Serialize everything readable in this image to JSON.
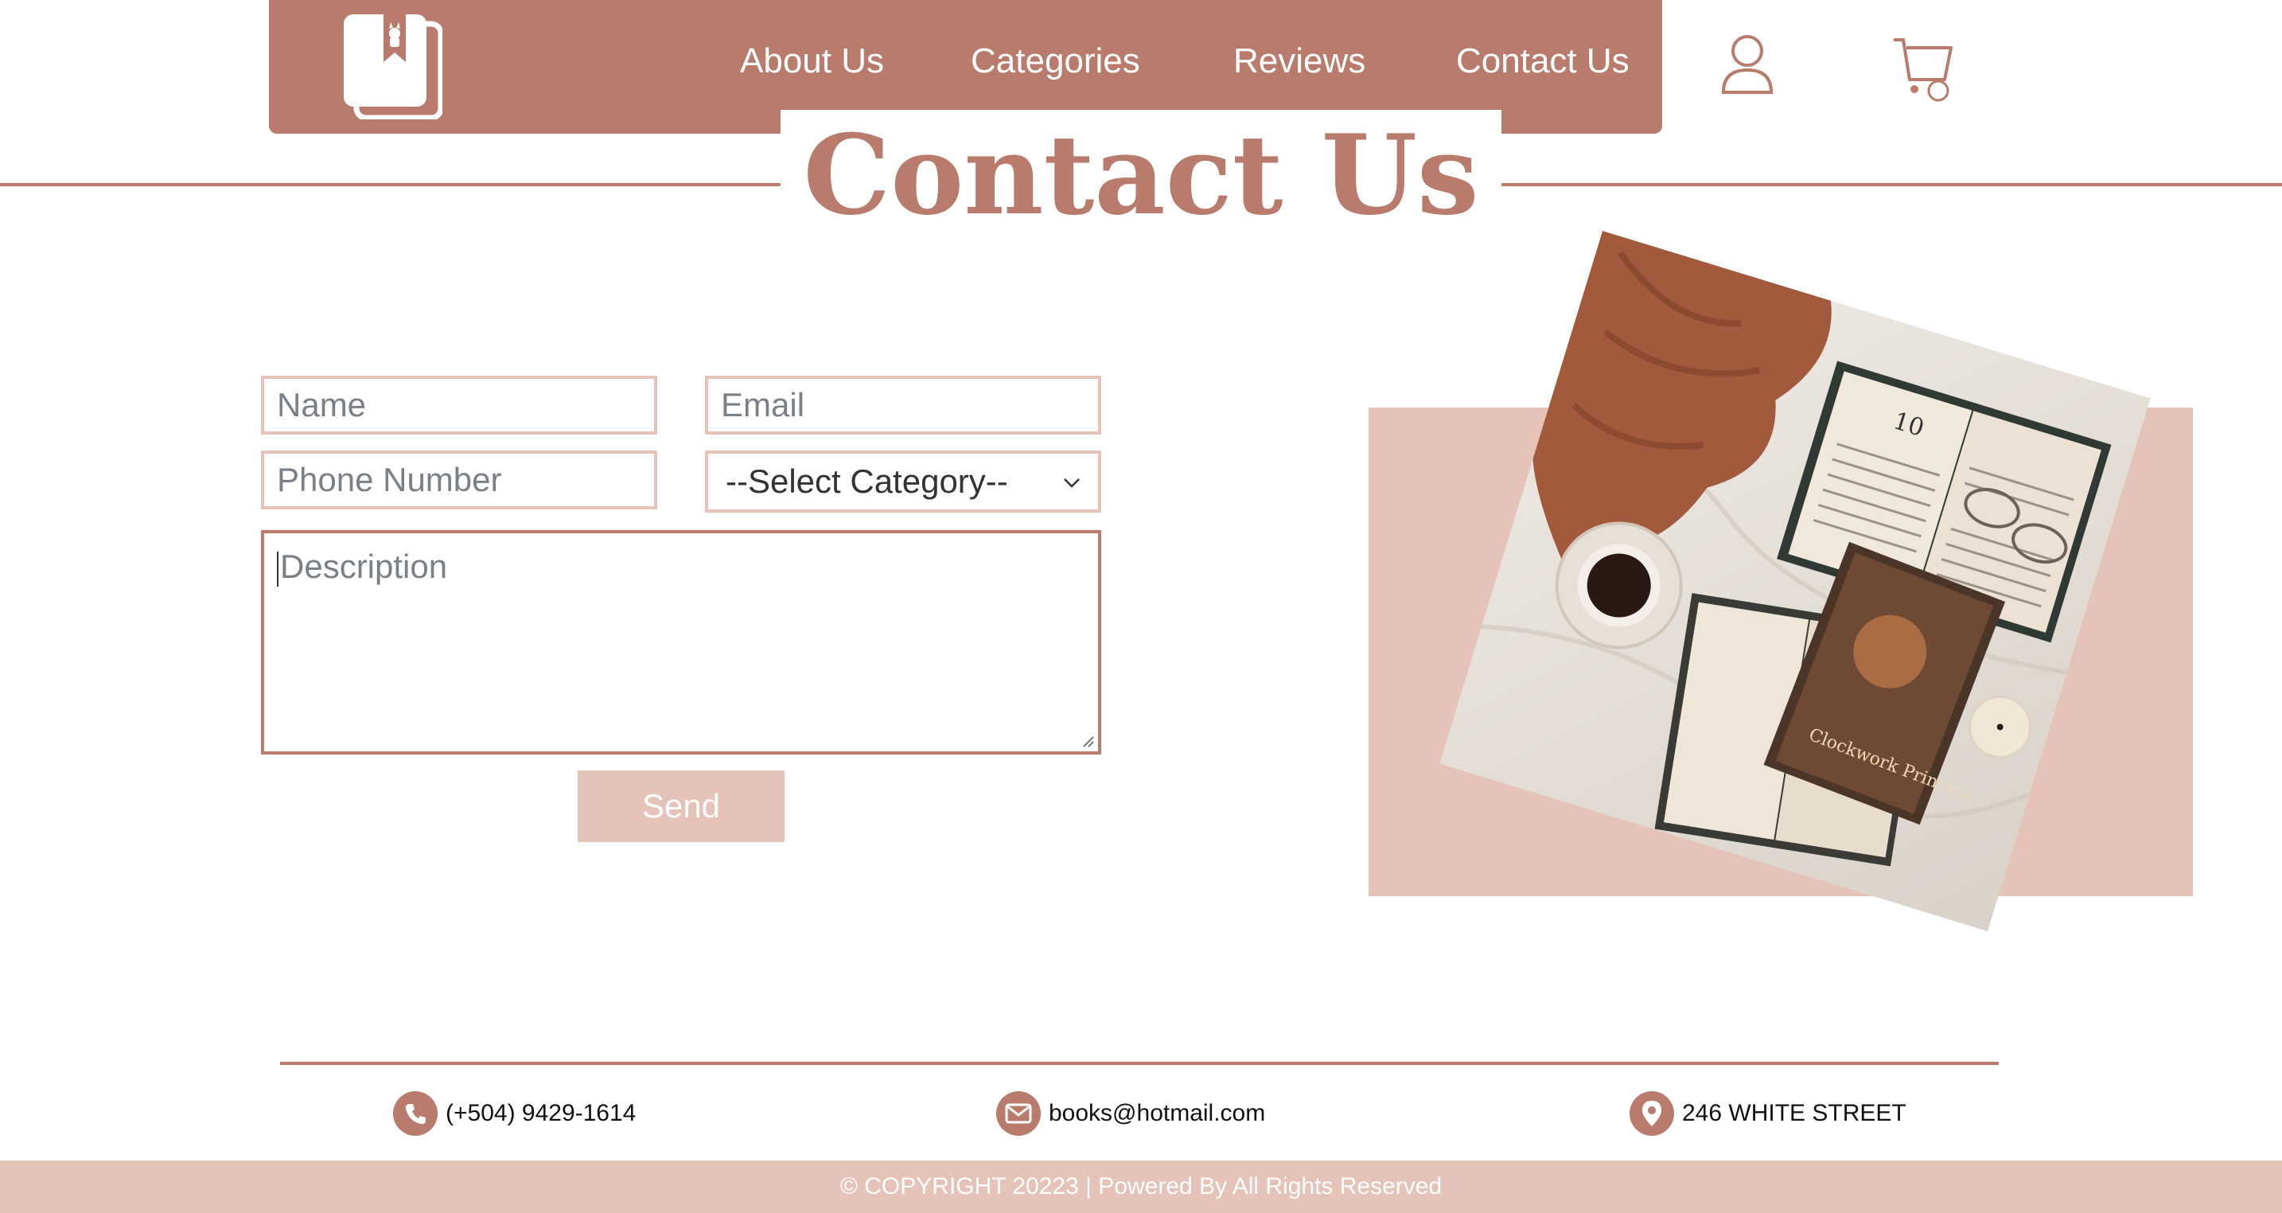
{
  "nav": {
    "links": [
      "About Us",
      "Categories",
      "Reviews",
      "Contact Us"
    ],
    "icons": [
      "books-logo-icon",
      "user-icon",
      "cart-icon"
    ]
  },
  "page": {
    "title": "Contact Us"
  },
  "form": {
    "name_placeholder": "Name",
    "email_placeholder": "Email",
    "phone_placeholder": "Phone Number",
    "category_selected": "--Select Category--",
    "description_placeholder": "Description",
    "send_label": "Send"
  },
  "footer": {
    "phone": "(+504) 9429-1614",
    "email": "books@hotmail.com",
    "address": "246 WHITE STREET",
    "copyright": "© COPYRIGHT 20223 | Powered By All Rights Reserved"
  },
  "photo": {
    "book_chapter": "10",
    "book_title": "Clockwork Princess"
  },
  "colors": {
    "brand": "#b97b6b",
    "accent_light": "#e6c3b8"
  }
}
